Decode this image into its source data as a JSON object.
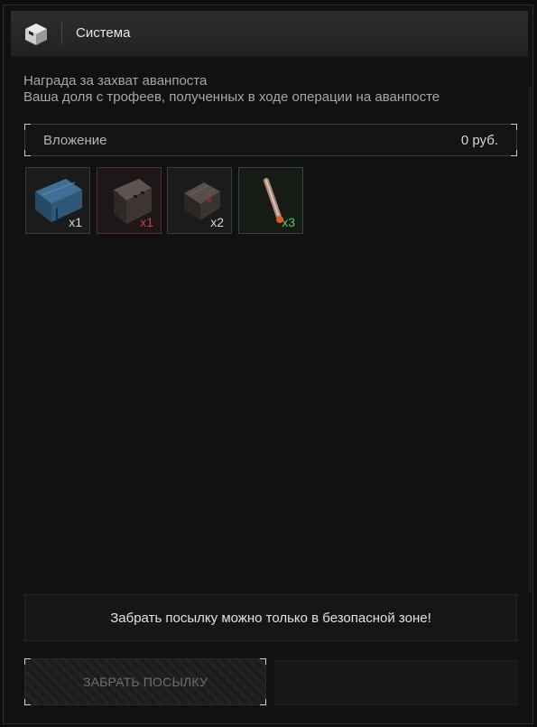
{
  "header": {
    "title": "Система",
    "logo_icon": "package-icon"
  },
  "message": {
    "line1": "Награда за захват аванпоста",
    "line2": "Ваша доля с трофеев, полученных в ходе операции на аванпосте"
  },
  "attachment": {
    "label": "Вложение",
    "value": "0  руб."
  },
  "items": [
    {
      "name": "blue-crate-icon",
      "qty": "x1",
      "rarity_color": "#d8d8d8"
    },
    {
      "name": "dark-box-icon",
      "qty": "x1",
      "rarity_color": "#d23a4b"
    },
    {
      "name": "small-case-icon",
      "qty": "x2",
      "rarity_color": "#d8d8d8"
    },
    {
      "name": "cartridge-icon",
      "qty": "x3",
      "rarity_color": "#5fc65c"
    }
  ],
  "notice": "Забрать посылку можно только в безопасной зоне!",
  "actions": {
    "claim_label": "ЗАБРАТЬ ПОСЫЛКУ"
  }
}
